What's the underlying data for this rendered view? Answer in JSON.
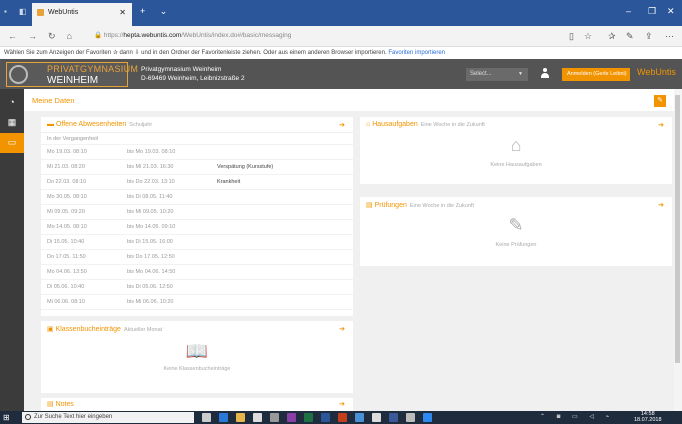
{
  "browser": {
    "tab_title": "WebUntis",
    "url_host": "hepta.webuntis.com",
    "url_path": "/WebUntis/index.do#/basic/messaging",
    "favbar_text": "Wählen Sie zum Anzeigen der Favoriten",
    "favbar_text2": "dann",
    "favbar_text3": "und in den Ordner der Favoritenleiste ziehen. Oder aus einem anderen Browser importieren.",
    "favbar_link": "Favoriten importieren"
  },
  "header": {
    "logo_line1": "PRIVATGYMNASIUM",
    "logo_line2": "WEINHEIM",
    "school_name": "Privatgymnasium Weinheim",
    "school_address": "D-69469 Weinheim, Leibnizstraße 2",
    "select_placeholder": "Select...",
    "login_label": "Anmelden (Gerle Leibni)",
    "brand": "WebUntis"
  },
  "main": {
    "title": "Meine Daten"
  },
  "absences": {
    "title": "Offene Abwesenheiten",
    "subtitle": "Schuljahr",
    "section_label": "In der Vergangenheit",
    "rows": [
      {
        "from": "Mo 19.03. 08:10",
        "to": "bis Mo 19.03. 08:10",
        "reason": ""
      },
      {
        "from": "Mi 21.03. 08:20",
        "to": "bis Mi 21.03. 16:30",
        "reason": "Verspätung (Kursstufe)"
      },
      {
        "from": "Do 22.03. 08:10",
        "to": "bis Do 22.03. 13:10",
        "reason": "Krankheit"
      },
      {
        "from": "Mo 30.05. 08:10",
        "to": "bis Di 08.05. 11:40",
        "reason": ""
      },
      {
        "from": "Mi 09.05. 09:20",
        "to": "bis Mi 09.05. 10:20",
        "reason": ""
      },
      {
        "from": "Mo 14.05. 08:10",
        "to": "bis Mo 14.05. 09:10",
        "reason": ""
      },
      {
        "from": "Di 15.05. 10:40",
        "to": "bis Di 15.05. 16:00",
        "reason": ""
      },
      {
        "from": "Do 17.05. 11:50",
        "to": "bis Do 17.05. 12:50",
        "reason": ""
      },
      {
        "from": "Mo 04.06. 13:50",
        "to": "bis Mo 04.06. 14:50",
        "reason": ""
      },
      {
        "from": "Di 05.06. 10:40",
        "to": "bis Di 05.06. 12:50",
        "reason": ""
      },
      {
        "from": "Mi 06.06. 08:10",
        "to": "bis Mi 06.06. 10:20",
        "reason": ""
      }
    ]
  },
  "homework": {
    "title": "Hausaufgaben",
    "subtitle": "Eine Woche in die Zukunft",
    "empty": "Keine Hausaufgaben"
  },
  "exams": {
    "title": "Prüfungen",
    "subtitle": "Eine Woche in die Zukunft",
    "empty": "Keine Prüfungen"
  },
  "classbook": {
    "title": "Klassenbucheinträge",
    "subtitle": "Aktueller Monat",
    "empty": "Keine Klassenbucheinträge"
  },
  "notes": {
    "title": "Notes"
  },
  "taskbar": {
    "search_placeholder": "Zur Suche Text hier eingeben",
    "time": "14:58",
    "date": "18.07.2018"
  },
  "colors": {
    "accent": "#f29400",
    "header": "#545454",
    "sidebar": "#3b3b3b",
    "titlebar": "#2b579a"
  }
}
